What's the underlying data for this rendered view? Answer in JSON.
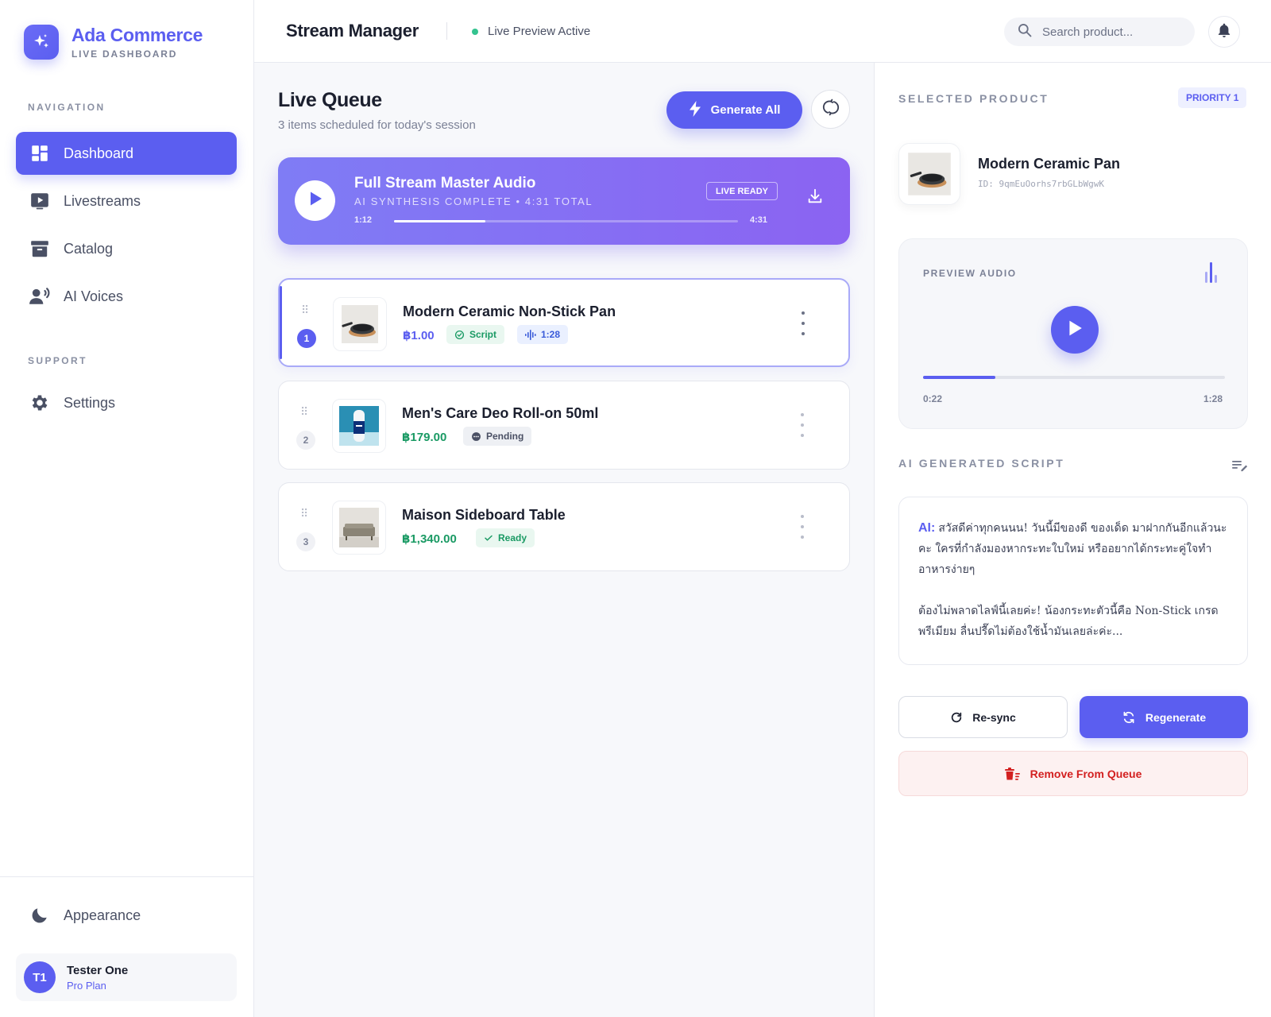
{
  "brand": {
    "name": "Ada Commerce",
    "subtitle": "LIVE DASHBOARD"
  },
  "sidebar": {
    "navigation_label": "NAVIGATION",
    "items": [
      {
        "label": "Dashboard",
        "icon": "dashboard-icon",
        "active": true
      },
      {
        "label": "Livestreams",
        "icon": "video-icon"
      },
      {
        "label": "Catalog",
        "icon": "archive-icon"
      },
      {
        "label": "AI Voices",
        "icon": "voice-icon"
      }
    ],
    "support_label": "SUPPORT",
    "support_items": [
      {
        "label": "Settings",
        "icon": "gear-icon"
      }
    ],
    "appearance_label": "Appearance"
  },
  "user": {
    "initials": "T1",
    "name": "Tester One",
    "plan": "Pro Plan"
  },
  "header": {
    "title": "Stream Manager",
    "status": "Live Preview Active",
    "search_placeholder": "Search product..."
  },
  "queue": {
    "title": "Live Queue",
    "subtitle": "3 items scheduled for today's session",
    "generate_label": "Generate All",
    "master": {
      "title": "Full Stream Master Audio",
      "subtitle": "AI SYNTHESIS COMPLETE • 4:31 TOTAL",
      "badge": "LIVE READY",
      "current": "1:12",
      "total": "4:31",
      "progress": 0.265
    },
    "items": [
      {
        "index": "1",
        "name": "Modern Ceramic Non-Stick Pan",
        "price": "฿1.00",
        "chips": [
          "Script",
          "1:28"
        ]
      },
      {
        "index": "2",
        "name": "Men's Care Deo Roll-on 50ml",
        "price": "฿179.00",
        "status": "Pending"
      },
      {
        "index": "3",
        "name": "Maison Sideboard Table",
        "price": "฿1,340.00",
        "status": "Ready"
      }
    ]
  },
  "selected": {
    "label": "SELECTED PRODUCT",
    "priority": "PRIORITY 1",
    "name": "Modern Ceramic Pan",
    "id": "ID: 9qmEuOorhs7rbGLbWgwK",
    "audio": {
      "label": "PREVIEW AUDIO",
      "current": "0:22",
      "total": "1:28",
      "progress": 0.24
    },
    "script_label": "AI GENERATED SCRIPT",
    "script": {
      "tag": "AI:",
      "para1": "สวัสดีค่าทุกคนนน! วันนี้มีของดี ของเด็ด มาฝากกันอีกแล้วนะคะ ใครที่กำลังมองหากระทะใบใหม่ หรืออยากได้กระทะคู่ใจทำอาหารง่ายๆ",
      "para2": "ต้องไม่พลาดไลฟ์นี้เลยค่ะ! น้องกระทะตัวนี้คือ Non-Stick เกรดพรีเมียม ลื่นปรื๊ดไม่ต้องใช้น้ำมันเลยล่ะค่ะ..."
    },
    "resync_label": "Re-sync",
    "regenerate_label": "Regenerate",
    "remove_label": "Remove From Queue"
  },
  "colors": {
    "accent": "#5b5ef0",
    "success": "#1a9a64",
    "danger": "#d32020"
  }
}
